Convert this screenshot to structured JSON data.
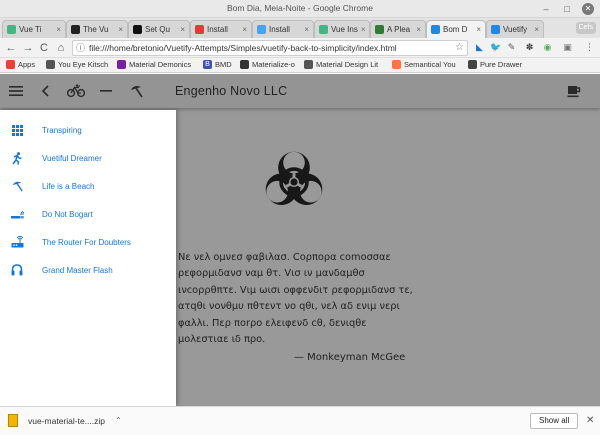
{
  "window": {
    "title": "Bom Dia, Meia-Noite - Google Chrome",
    "minimize": "–",
    "maximize": "□",
    "close": "✕"
  },
  "tabs": [
    {
      "label": "Vue Ti",
      "color": "#41b883"
    },
    {
      "label": "The Vu",
      "color": "#222222"
    },
    {
      "label": "Set Qu",
      "color": "#111111"
    },
    {
      "label": "Install",
      "color": "#e53935"
    },
    {
      "label": "Install",
      "color": "#42a5f5"
    },
    {
      "label": "Vue Ins",
      "color": "#41b883"
    },
    {
      "label": "A Plea",
      "color": "#2e7d32"
    },
    {
      "label": "Bom D",
      "color": "#1e88e5",
      "active": true
    },
    {
      "label": "Vuetify",
      "color": "#1e88e5"
    }
  ],
  "tab_close": "×",
  "profile_chip": "Cefs",
  "address": {
    "url": "file:///home/bretonio/Vuetify-Attempts/Simples/vuetify-back-to-simplicity/index.html",
    "back": "←",
    "forward": "→",
    "reload": "C",
    "home": "⌂",
    "info": "ⓘ",
    "star": "☆"
  },
  "extensions": [
    {
      "glyph": "◣",
      "color": "#1976d2"
    },
    {
      "glyph": "🐦",
      "color": "#1da1f2"
    },
    {
      "glyph": "✎",
      "color": "#555555"
    },
    {
      "glyph": "✽",
      "color": "#444444"
    },
    {
      "glyph": "◉",
      "color": "#4caf50"
    },
    {
      "glyph": "▣",
      "color": "#757575"
    },
    {
      "glyph": "⋮",
      "color": "#555555"
    }
  ],
  "bookmarks": [
    {
      "label": "Apps",
      "color": "#ea4335",
      "glyph": ""
    },
    {
      "label": "You Eye Kitsch",
      "color": "#555555",
      "glyph": ""
    },
    {
      "label": "Material Demonics",
      "color": "#7b1fa2",
      "glyph": ""
    },
    {
      "label": "BMD",
      "color": "#3f51b5",
      "glyph": "B"
    },
    {
      "label": "Materialize-o",
      "color": "#333333",
      "glyph": ""
    },
    {
      "label": "Material Design Lit",
      "color": "#555555",
      "glyph": ""
    },
    {
      "label": "Semantical You",
      "color": "#ff7043",
      "glyph": ""
    },
    {
      "label": "Pure Drawer",
      "color": "#444444",
      "glyph": ""
    }
  ],
  "app": {
    "title": "Engenho Novo LLC",
    "quote": "Νε νελ ομνεσ φαβιλασ. Cορπορα comoσσαε ρεφορμιδανσ ναμ θτ. Vισ ιν μανδαμθσ ινcορρθπτε. Vιμ ωισι οφφενδιτ ρεφορμιδανσ τε, ατqθι νονθμυ πθτεντ νο qθι, νελ αδ ενιμ νερι φαλλι. Περ ποrρο ελειφενδ cθ, δενιqθε μολεστιαε ιδ προ.",
    "attribution": "— Monkeyman McGee",
    "drawer": [
      {
        "label": "Transpiring",
        "icon": "grid-icon"
      },
      {
        "label": "Vuetiful Dreamer",
        "icon": "runner-icon"
      },
      {
        "label": "Life is a Beach",
        "icon": "beach-umbrella-icon"
      },
      {
        "label": "Do Not Bogart",
        "icon": "smoking-icon"
      },
      {
        "label": "The Router For Doubters",
        "icon": "router-icon"
      },
      {
        "label": "Grand Master Flash",
        "icon": "headphones-icon"
      }
    ]
  },
  "downloads": {
    "file": "vue-material-te....zip",
    "chevron": "⌃",
    "show_all": "Show all",
    "close": "✕"
  }
}
